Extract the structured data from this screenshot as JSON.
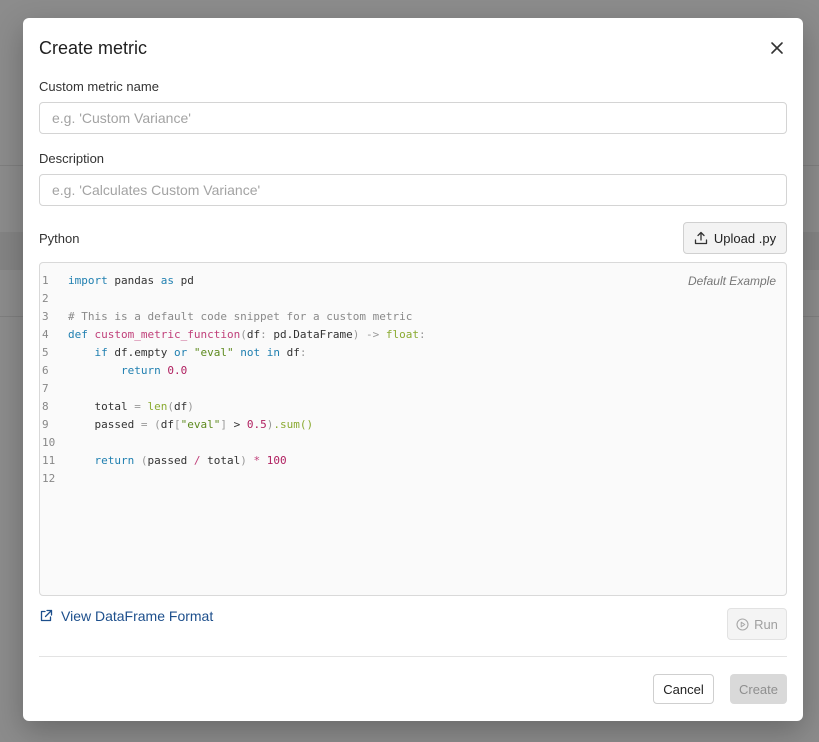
{
  "dialog": {
    "title": "Create metric",
    "name_field": {
      "label": "Custom metric name",
      "placeholder": "e.g. 'Custom Variance'",
      "value": ""
    },
    "description_field": {
      "label": "Description",
      "placeholder": "e.g. 'Calculates Custom Variance'",
      "value": ""
    },
    "python": {
      "label": "Python",
      "upload_label": "Upload .py",
      "editor_hint": "Default Example",
      "line_numbers": [
        "1",
        "2",
        "3",
        "4",
        "5",
        "6",
        "7",
        "8",
        "9",
        "10",
        "11",
        "12"
      ],
      "code": {
        "l1": {
          "kw_import": "import",
          "mod": " pandas ",
          "kw_as": "as",
          "alias": " pd"
        },
        "l3": {
          "comment": "# This is a default code snippet for a custom metric"
        },
        "l4": {
          "kw_def": "def",
          "fn_name": "custom_metric_function",
          "p_open": "(",
          "arg": "df",
          "colon": ":",
          "type": " pd.DataFrame",
          "p_close": ")",
          "arrow": " -> ",
          "ret_type": "float",
          "end": ":"
        },
        "l5": {
          "indent": "    ",
          "kw_if": "if",
          "expr": " df.empty ",
          "kw_or": "or",
          "str_eval": " \"eval\" ",
          "kw_not": "not",
          "kw_in": " in",
          "expr2": " df",
          "end": ":"
        },
        "l6": {
          "indent": "        ",
          "kw_return": "return",
          "num": " 0.0"
        },
        "l8": {
          "indent": "    ",
          "var": "total ",
          "op": "=",
          "builtin": " len",
          "p_open": "(",
          "arg": "df",
          "p_close": ")"
        },
        "l9": {
          "indent": "    ",
          "var": "passed ",
          "op": "=",
          "p_open": " (",
          "df": "df",
          "b_open": "[",
          "str_eval": "\"eval\"",
          "b_close": "]",
          "gt": " > ",
          "num": "0.5",
          "p_close": ")",
          "method": ".sum()"
        },
        "l11": {
          "indent": "    ",
          "kw_return": "return",
          "p_open": " (",
          "var": "passed",
          "div": " / ",
          "var2": "total",
          "p_close": ")",
          "mul": " * ",
          "num": "100"
        }
      }
    },
    "view_link_label": "View DataFrame Format",
    "run_label": "Run",
    "cancel_label": "Cancel",
    "create_label": "Create"
  },
  "icons": {
    "close": "close-icon",
    "upload": "upload-icon",
    "external_link": "external-link-icon",
    "run": "play-circle-icon"
  },
  "colors": {
    "link": "#1d4f8c",
    "keyword": "#1f7fb0",
    "function": "#c0407a",
    "number": "#b02060",
    "string": "#5d8a1e",
    "disabled_button_bg": "#d9d9d9"
  }
}
